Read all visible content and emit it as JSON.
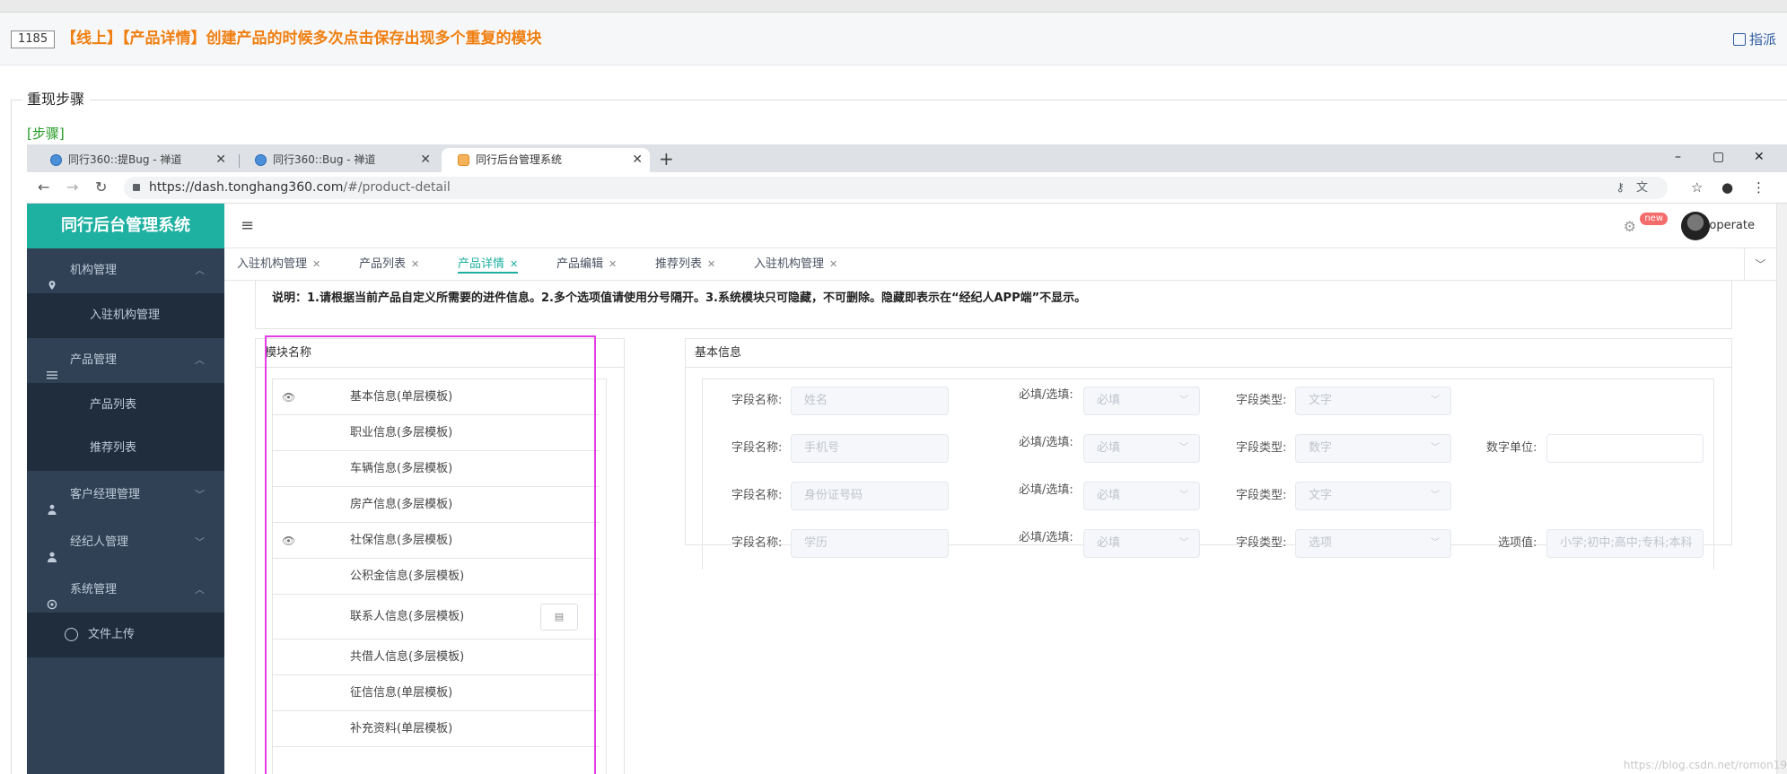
{
  "bug": {
    "id": "1185",
    "title": "【线上】【产品详情】创建产品的时候多次点击保存出现多个重复的模块",
    "assign_label": "指派"
  },
  "section": {
    "legend": "重现步骤",
    "steps_label": "[步骤]"
  },
  "browser": {
    "tabs": [
      {
        "title": "同行360::提Bug - 禅道"
      },
      {
        "title": "同行360::Bug - 禅道"
      },
      {
        "title": "同行后台管理系统"
      }
    ],
    "new_tab": "+",
    "url_host": "https://dash.tonghang360.com",
    "url_path": "/#/product-detail",
    "window_controls": {
      "minimize": "–",
      "maximize": "▢",
      "close": "✕"
    },
    "nav": {
      "back": "←",
      "forward": "→",
      "reload": "↻"
    },
    "icons": {
      "key": "key-icon",
      "translate": "translate-icon",
      "star": "star-icon",
      "account": "account-icon",
      "menu": "more-icon"
    }
  },
  "app": {
    "brand": "同行后台管理系统",
    "accent": "#1eb0a0",
    "sidebar_bg": "#304156",
    "menu": [
      {
        "label": "机构管理",
        "icon": "location-icon",
        "expanded": true,
        "children": [
          "入驻机构管理"
        ]
      },
      {
        "label": "产品管理",
        "icon": "list-icon",
        "expanded": true,
        "children": [
          "产品列表",
          "推荐列表"
        ]
      },
      {
        "label": "客户经理管理",
        "icon": "manager-icon",
        "expanded": false,
        "children": []
      },
      {
        "label": "经纪人管理",
        "icon": "user-icon",
        "expanded": false,
        "children": []
      },
      {
        "label": "系统管理",
        "icon": "gear-icon",
        "expanded": true,
        "children": [
          "文件上传"
        ]
      }
    ],
    "navbar": {
      "badge": "new",
      "username": "operate"
    },
    "tags": [
      {
        "label": "入驻机构管理",
        "active": false
      },
      {
        "label": "产品列表",
        "active": false
      },
      {
        "label": "产品详情",
        "active": true
      },
      {
        "label": "产品编辑",
        "active": false
      },
      {
        "label": "推荐列表",
        "active": false
      },
      {
        "label": "入驻机构管理",
        "active": false
      }
    ],
    "notice": "说明：1.请根据当前产品自定义所需要的进件信息。2.多个选项值请使用分号隔开。3.系统模块只可隐藏，不可删除。隐藏即表示在“经纪人APP端”不显示。",
    "modules_panel": {
      "title": "模块名称",
      "rows": [
        {
          "label": "基本信息(单层模板)",
          "eye": true,
          "doc": false
        },
        {
          "label": "职业信息(多层模板)",
          "eye": false,
          "doc": false
        },
        {
          "label": "车辆信息(多层模板)",
          "eye": false,
          "doc": false
        },
        {
          "label": "房产信息(多层模板)",
          "eye": false,
          "doc": false
        },
        {
          "label": "社保信息(多层模板)",
          "eye": true,
          "doc": false
        },
        {
          "label": "公积金信息(多层模板)",
          "eye": false,
          "doc": false
        },
        {
          "label": "联系人信息(多层模板)",
          "eye": false,
          "doc": true
        },
        {
          "label": "共借人信息(多层模板)",
          "eye": false,
          "doc": false
        },
        {
          "label": "征信信息(单层模板)",
          "eye": false,
          "doc": false
        },
        {
          "label": "补充资料(单层模板)",
          "eye": false,
          "doc": false
        }
      ]
    },
    "basic_panel": {
      "title": "基本信息",
      "labels": {
        "field_name": "字段名称:",
        "required": "必填/选填:",
        "field_type": "字段类型:"
      },
      "rows": [
        {
          "name": "姓名",
          "required": "必填",
          "type": "文字",
          "extra_label": "",
          "extra_value": ""
        },
        {
          "name": "手机号",
          "required": "必填",
          "type": "数字",
          "extra_label": "数字单位:",
          "extra_value": ""
        },
        {
          "name": "身份证号码",
          "required": "必填",
          "type": "文字",
          "extra_label": "",
          "extra_value": ""
        },
        {
          "name": "学历",
          "required": "必填",
          "type": "选项",
          "extra_label": "选项值:",
          "extra_value": "小学;初中;高中;专科;本科"
        }
      ]
    }
  },
  "watermark": "https://blog.csdn.net/romon19"
}
